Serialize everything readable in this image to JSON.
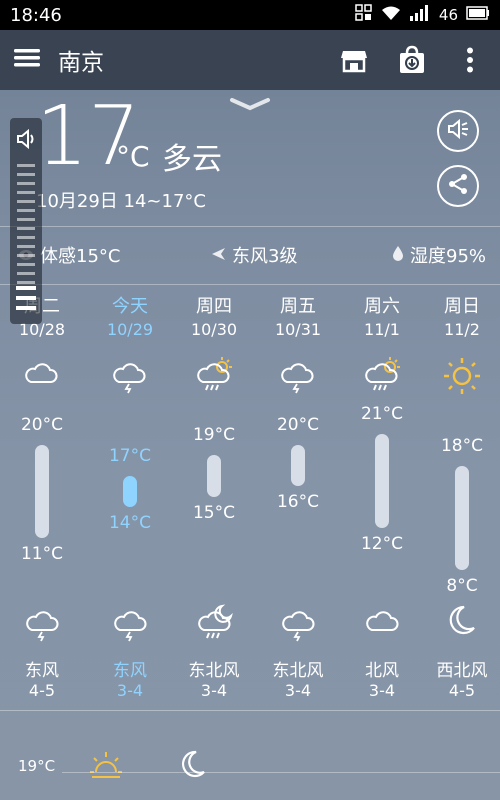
{
  "status_bar": {
    "time": "18:46",
    "signal_text": "46"
  },
  "app_bar": {
    "city": "南京"
  },
  "current": {
    "temperature": "17",
    "unit": "°C",
    "description": "多云",
    "date_range": "10月29日 14~17°C"
  },
  "details": {
    "feels_like": "体感15°C",
    "wind": "东风3级",
    "humidity": "湿度95%"
  },
  "forecast": [
    {
      "day": "周二",
      "date": "10/28",
      "high": "20°C",
      "low": "11°C",
      "high_value": 20,
      "low_value": 11,
      "day_icon": "cloud-icon",
      "night_icon": "cloud-rain-icon",
      "wind_dir": "东风",
      "wind_level": "4-5"
    },
    {
      "day": "今天",
      "date": "10/29",
      "high": "17°C",
      "low": "14°C",
      "high_value": 17,
      "low_value": 14,
      "day_icon": "cloud-rain-icon",
      "night_icon": "cloud-rain-icon",
      "wind_dir": "东风",
      "wind_level": "3-4"
    },
    {
      "day": "周四",
      "date": "10/30",
      "high": "19°C",
      "low": "15°C",
      "high_value": 19,
      "low_value": 15,
      "day_icon": "sun-cloud-rain-icon",
      "night_icon": "moon-cloud-rain-icon",
      "wind_dir": "东北风",
      "wind_level": "3-4"
    },
    {
      "day": "周五",
      "date": "10/31",
      "high": "20°C",
      "low": "16°C",
      "high_value": 20,
      "low_value": 16,
      "day_icon": "cloud-rain-icon",
      "night_icon": "cloud-rain-icon",
      "wind_dir": "东北风",
      "wind_level": "3-4"
    },
    {
      "day": "周六",
      "date": "11/1",
      "high": "21°C",
      "low": "12°C",
      "high_value": 21,
      "low_value": 12,
      "day_icon": "sun-cloud-rain-icon",
      "night_icon": "cloud-icon",
      "wind_dir": "北风",
      "wind_level": "3-4"
    },
    {
      "day": "周日",
      "date": "11/2",
      "high": "18°C",
      "low": "8°C",
      "high_value": 18,
      "low_value": 8,
      "day_icon": "sun-icon",
      "night_icon": "moon-icon",
      "wind_dir": "西北风",
      "wind_level": "4-5"
    }
  ],
  "bottom": {
    "temperature": "19°C"
  },
  "colors": {
    "today": "#8fd3ff",
    "sun": "#f5c242",
    "app_bar": "#343e4c"
  }
}
